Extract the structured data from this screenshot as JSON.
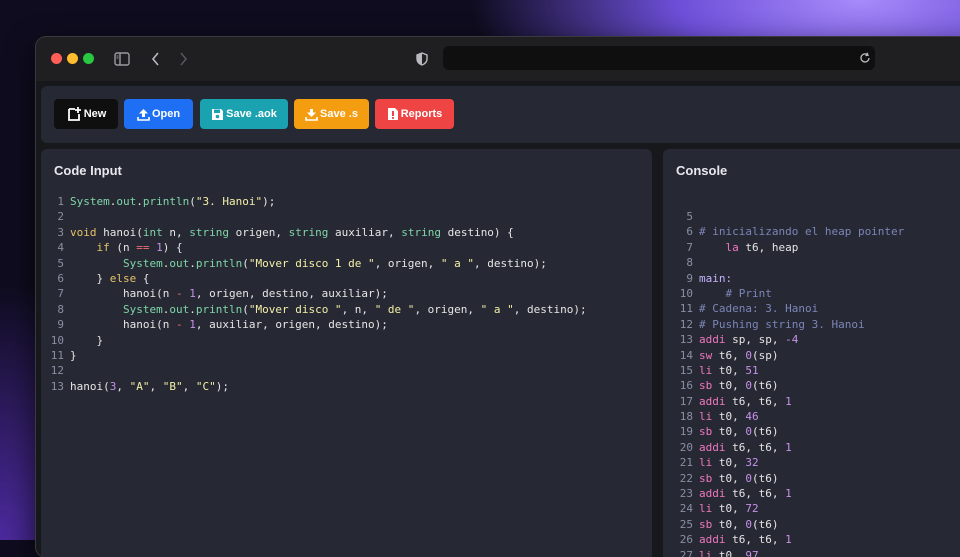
{
  "browser": {
    "url": "",
    "icons": [
      "sidebar-icon",
      "back-icon",
      "forward-icon",
      "shield-icon",
      "reload-icon"
    ]
  },
  "toolbar": {
    "buttons": [
      {
        "label": "New",
        "icon": "new-file-icon",
        "color": "#0f0f10"
      },
      {
        "label": "Open",
        "icon": "upload-icon",
        "color": "#1e6ff3"
      },
      {
        "label": "Save .aok",
        "icon": "save-icon",
        "color": "#1aa2b0"
      },
      {
        "label": "Save .s",
        "icon": "download-icon",
        "color": "#f59d10"
      },
      {
        "label": "Reports",
        "icon": "report-icon",
        "color": "#ee4444"
      }
    ]
  },
  "editor": {
    "title": "Code Input",
    "lines": [
      {
        "n": "1",
        "code": "System.out.println(\"3. Hanoi\");"
      },
      {
        "n": "2",
        "code": ""
      },
      {
        "n": "3",
        "code": "void hanoi(int n, string origen, string auxiliar, string destino) {"
      },
      {
        "n": "4",
        "code": "    if (n == 1) {"
      },
      {
        "n": "5",
        "code": "        System.out.println(\"Mover disco 1 de \", origen, \" a \", destino);"
      },
      {
        "n": "6",
        "code": "    } else {"
      },
      {
        "n": "7",
        "code": "        hanoi(n - 1, origen, destino, auxiliar);"
      },
      {
        "n": "8",
        "code": "        System.out.println(\"Mover disco \", n, \" de \", origen, \" a \", destino);"
      },
      {
        "n": "9",
        "code": "        hanoi(n - 1, auxiliar, origen, destino);"
      },
      {
        "n": "10",
        "code": "    }"
      },
      {
        "n": "11",
        "code": "}"
      },
      {
        "n": "12",
        "code": ""
      },
      {
        "n": "13",
        "code": "hanoi(3, \"A\", \"B\", \"C\");"
      }
    ]
  },
  "console": {
    "title": "Console",
    "lines": [
      {
        "n": "5",
        "code": ""
      },
      {
        "n": "6",
        "code": "# inicializando el heap pointer"
      },
      {
        "n": "7",
        "code": "    la t6, heap"
      },
      {
        "n": "8",
        "code": ""
      },
      {
        "n": "9",
        "code": "main:"
      },
      {
        "n": "10",
        "code": "    # Print"
      },
      {
        "n": "11",
        "code": "# Cadena: 3. Hanoi"
      },
      {
        "n": "12",
        "code": "# Pushing string 3. Hanoi"
      },
      {
        "n": "13",
        "code": "addi sp, sp, -4"
      },
      {
        "n": "14",
        "code": "sw t6, 0(sp)"
      },
      {
        "n": "15",
        "code": "li t0, 51"
      },
      {
        "n": "16",
        "code": "sb t0, 0(t6)"
      },
      {
        "n": "17",
        "code": "addi t6, t6, 1"
      },
      {
        "n": "18",
        "code": "li t0, 46"
      },
      {
        "n": "19",
        "code": "sb t0, 0(t6)"
      },
      {
        "n": "20",
        "code": "addi t6, t6, 1"
      },
      {
        "n": "21",
        "code": "li t0, 32"
      },
      {
        "n": "22",
        "code": "sb t0, 0(t6)"
      },
      {
        "n": "23",
        "code": "addi t6, t6, 1"
      },
      {
        "n": "24",
        "code": "li t0, 72"
      },
      {
        "n": "25",
        "code": "sb t0, 0(t6)"
      },
      {
        "n": "26",
        "code": "addi t6, t6, 1"
      },
      {
        "n": "27",
        "code": "li t0, 97"
      }
    ]
  }
}
